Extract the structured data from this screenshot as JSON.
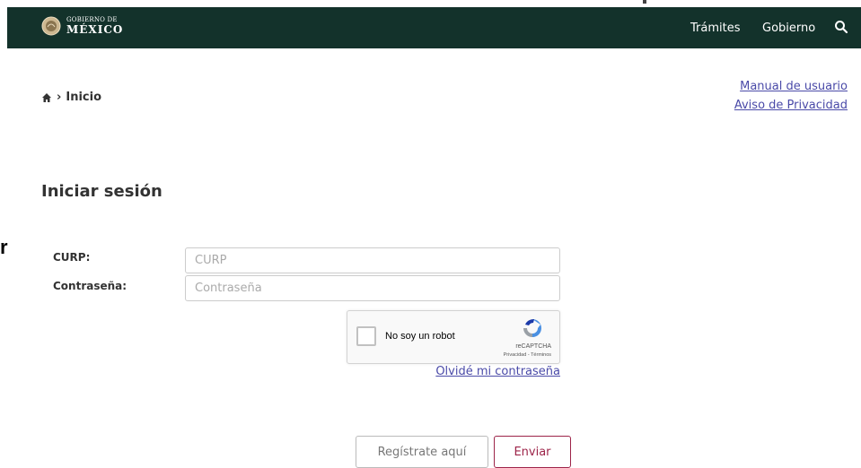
{
  "header": {
    "logo_small": "GOBIERNO DE",
    "logo_big": "MÉXICO",
    "nav": [
      {
        "label": "Trámites"
      },
      {
        "label": "Gobierno"
      }
    ],
    "search_icon": "search-icon",
    "bg_color": "#13322b"
  },
  "breadcrumb": {
    "home_icon": "home-icon",
    "separator": "›",
    "current": "Inicio"
  },
  "links": {
    "manual": "Manual de usuario",
    "aviso": "Aviso de Privacidad",
    "color": "#4a4aa8"
  },
  "edge_text": "r",
  "form": {
    "title": "Iniciar sesión",
    "curp_label": "CURP:",
    "curp_placeholder": "CURP",
    "curp_value": "",
    "password_label": "Contraseña:",
    "password_placeholder": "Contraseña",
    "password_value": "",
    "forgot": "Olvidé mi contraseña"
  },
  "recaptcha": {
    "label": "No soy un robot",
    "brand": "reCAPTCHA",
    "terms": "Privacidad - Términos",
    "checked": false
  },
  "buttons": {
    "register": "Regístrate aquí",
    "submit": "Enviar",
    "accent_color": "#9d2449"
  }
}
